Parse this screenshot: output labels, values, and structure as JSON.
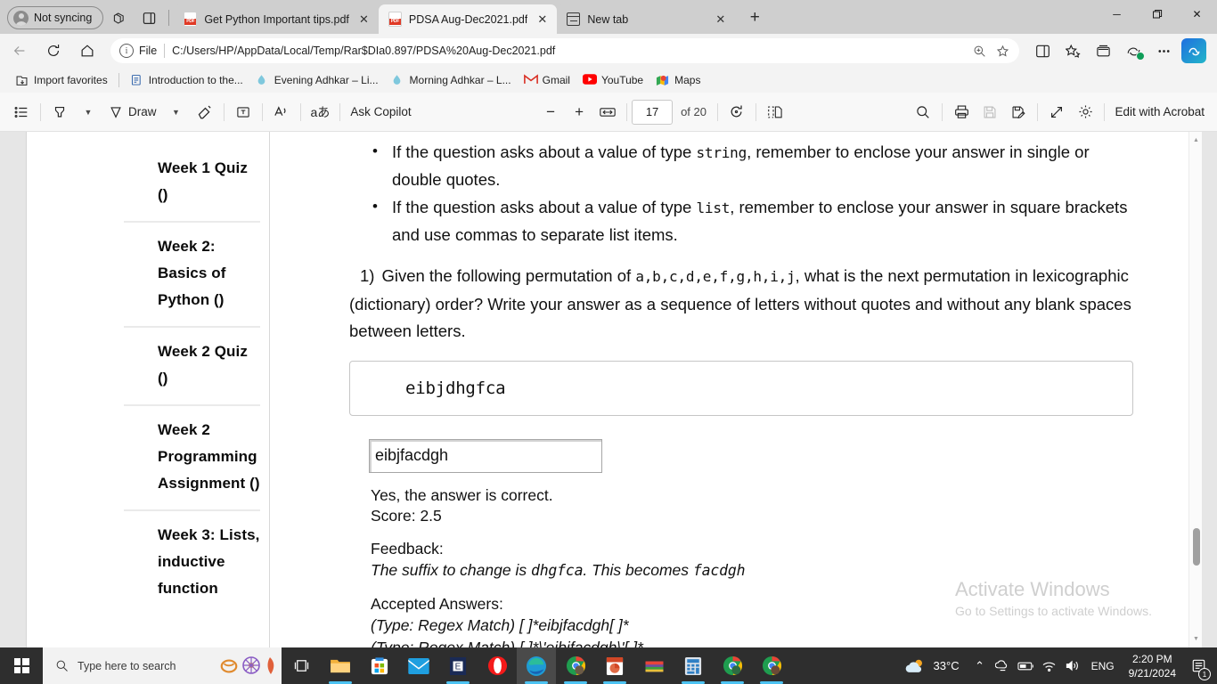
{
  "browser": {
    "profile_label": "Not syncing",
    "tabs": [
      {
        "title": "Get Python Important tips.pdf",
        "icon": "pdf-icon",
        "active": false
      },
      {
        "title": "PDSA Aug-Dec2021.pdf",
        "icon": "pdf-icon",
        "active": true
      },
      {
        "title": "New tab",
        "icon": "new-tab-icon",
        "active": false
      }
    ],
    "new_tab_label": "+",
    "window_controls": {
      "minimize": "─",
      "maximize": "❐",
      "close": "✕"
    },
    "address": {
      "scheme_label": "File",
      "url": "C:/Users/HP/AppData/Local/Temp/Rar$DIa0.897/PDSA%20Aug-Dec2021.pdf"
    },
    "bookmarks": [
      {
        "label": "Import favorites",
        "icon": "import-favorites-icon"
      },
      {
        "label": "Introduction to the...",
        "icon": "document-icon"
      },
      {
        "label": "Evening Adhkar – Li...",
        "icon": "droplet-icon"
      },
      {
        "label": "Morning Adhkar – L...",
        "icon": "droplet-icon"
      },
      {
        "label": "Gmail",
        "icon": "gmail-icon"
      },
      {
        "label": "YouTube",
        "icon": "youtube-icon"
      },
      {
        "label": "Maps",
        "icon": "maps-icon"
      }
    ]
  },
  "pdf_toolbar": {
    "draw_label": "Draw",
    "ask_copilot_label": "Ask Copilot",
    "page_current": "17",
    "page_total_label": "of 20",
    "edit_with_acrobat_label": "Edit with Acrobat",
    "zoom_out_label": "−",
    "zoom_in_label": "+"
  },
  "course_nav": {
    "items": [
      {
        "label": "Week 1 Quiz ()"
      },
      {
        "label": "Week 2: Basics of Python ()"
      },
      {
        "label": "Week 2 Quiz ()"
      },
      {
        "label": "Week 2 Programming Assignment ()"
      },
      {
        "label": "Week 3: Lists, inductive function"
      }
    ]
  },
  "document": {
    "bullets": [
      {
        "pre": "If the question asks about a value of type ",
        "code": "string",
        "post": ", remember to enclose your answer in single or double quotes."
      },
      {
        "pre": "If the question asks about a value of type ",
        "code": "list",
        "post": ", remember to enclose your answer in square brackets and use commas to separate list items."
      }
    ],
    "question": {
      "number": "1)",
      "part1": "Given the following permutation of ",
      "code": "a,b,c,d,e,f,g,h,i,j",
      "part2": ", what is the next permutation in lexicographic (dictionary) order? Write your answer as a sequence of letters without quotes and without any blank spaces between letters."
    },
    "permutation_value": "eibjdhgfca",
    "answer_input_value": "eibjfacdgh",
    "result": {
      "correct_line": "Yes, the answer is correct.",
      "score_line": "Score: 2.5",
      "feedback_label": "Feedback:",
      "feedback_pre": "The suffix to change is ",
      "feedback_code1": "dhgfca",
      "feedback_mid": ". This becomes ",
      "feedback_code2": "facdgh",
      "accepted_label": "Accepted Answers:",
      "accepted": [
        "(Type: Regex Match) [ ]*eibjfacdgh[ ]*",
        "(Type: Regex Match) [ ]*\\'eibjfacdgh\\'[ ]*"
      ]
    }
  },
  "watermark": {
    "title": "Activate Windows",
    "subtitle": "Go to Settings to activate Windows."
  },
  "taskbar": {
    "search_placeholder": "Type here to search",
    "temperature": "33°C",
    "language": "ENG",
    "time": "2:20 PM",
    "date": "9/21/2024",
    "notification_count": "1"
  },
  "colors": {
    "tabstrip_bg": "#cfcfcf",
    "chrome_bg": "#f3f3f3",
    "viewer_bg": "#e6e6e6",
    "taskbar_bg": "#2e2e2e",
    "accent_blue": "#4cc2f1",
    "pdf_red": "#e03a26"
  }
}
